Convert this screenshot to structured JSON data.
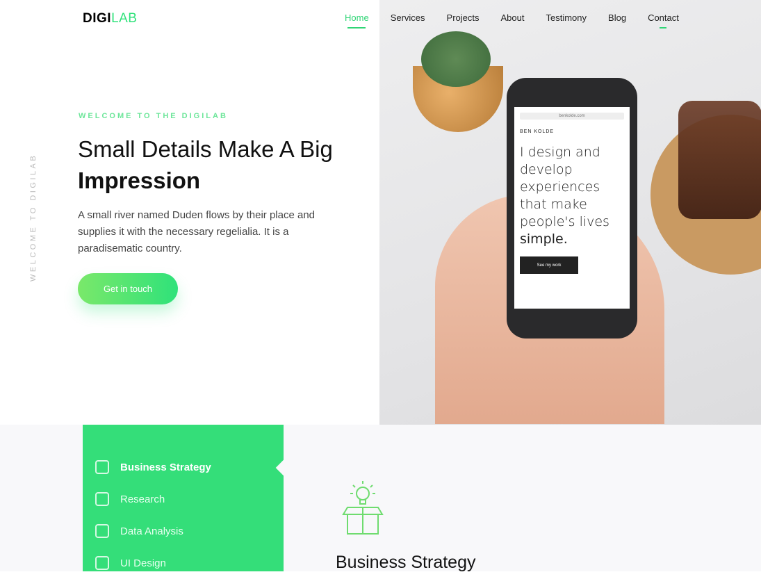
{
  "logo": {
    "part1": "DIGI",
    "part2": "LAB"
  },
  "nav": [
    {
      "label": "Home",
      "active": true
    },
    {
      "label": "Services"
    },
    {
      "label": "Projects"
    },
    {
      "label": "About"
    },
    {
      "label": "Testimony"
    },
    {
      "label": "Blog"
    },
    {
      "label": "Contact"
    }
  ],
  "hero": {
    "vertical": "WELCOME TO DIGILAB",
    "welcome": "WELCOME TO THE DIGILAB",
    "title_line1": "Small Details Make A Big",
    "title_line2": "Impression",
    "description": "A small river named Duden flows by their place and supplies it with the necessary regelialia. It is a paradisematic country.",
    "cta": "Get in touch"
  },
  "phone": {
    "url": "benkolde.com",
    "brand": "BEN KOLDE",
    "tagline": "I design and develop experiences that make people's lives",
    "tagline_bold": "simple.",
    "button": "See my work"
  },
  "services": {
    "items": [
      {
        "label": "Business Strategy",
        "icon": "business-strategy-icon"
      },
      {
        "label": "Research",
        "icon": "research-icon"
      },
      {
        "label": "Data Analysis",
        "icon": "data-analysis-icon"
      },
      {
        "label": "UI Design",
        "icon": "ui-design-icon"
      }
    ],
    "active_title": "Business Strategy"
  },
  "colors": {
    "accent": "#34de79"
  }
}
